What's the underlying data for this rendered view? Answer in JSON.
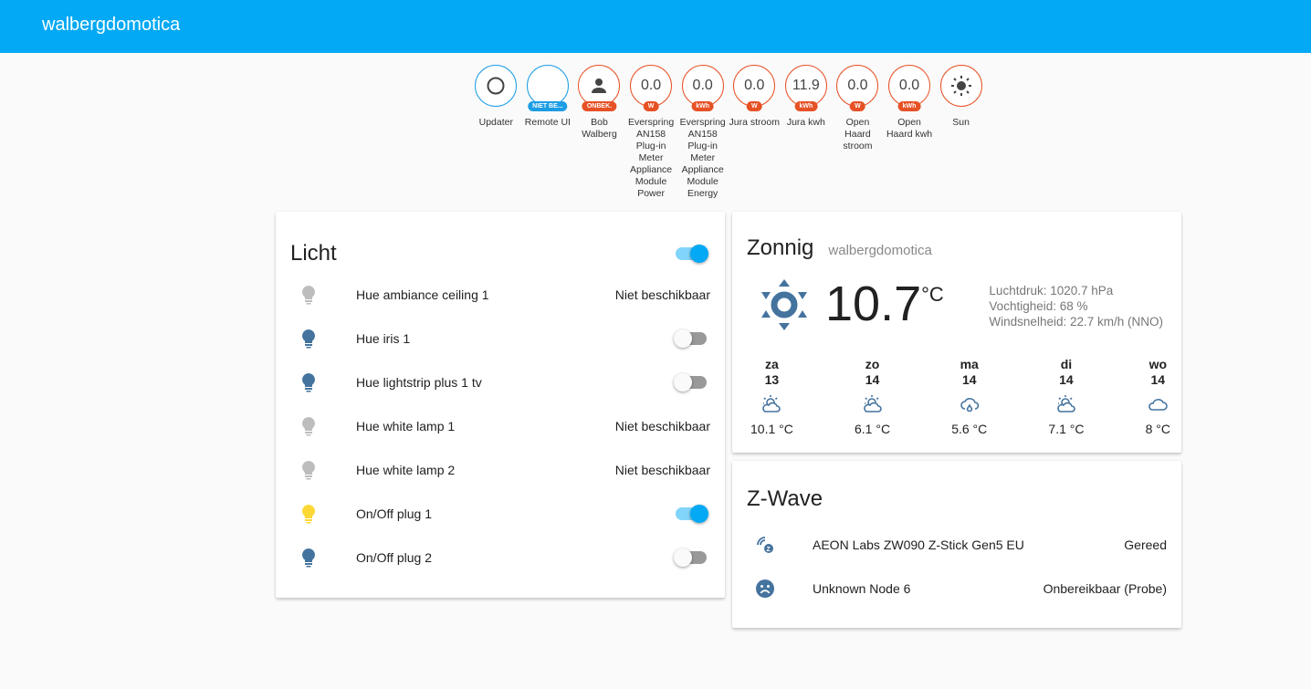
{
  "header": {
    "title": "walbergdomotica"
  },
  "badges": [
    {
      "value": "",
      "icon": "circle-outline-icon",
      "tag": "",
      "label": "Updater",
      "color": "blue"
    },
    {
      "value": "",
      "icon": "",
      "tag": "NIET BE...",
      "label": "Remote UI",
      "color": "blue"
    },
    {
      "value": "",
      "icon": "person-icon",
      "tag": "ONBEK.",
      "label": "Bob Walberg",
      "color": "red"
    },
    {
      "value": "0.0",
      "icon": "",
      "tag": "W",
      "label": "Everspring AN158 Plug-in Meter Appliance Module Power",
      "color": "red"
    },
    {
      "value": "0.0",
      "icon": "",
      "tag": "kWh",
      "label": "Everspring AN158 Plug-in Meter Appliance Module Energy",
      "color": "red"
    },
    {
      "value": "0.0",
      "icon": "",
      "tag": "W",
      "label": "Jura stroom",
      "color": "red"
    },
    {
      "value": "11.9",
      "icon": "",
      "tag": "kWh",
      "label": "Jura kwh",
      "color": "red"
    },
    {
      "value": "0.0",
      "icon": "",
      "tag": "W",
      "label": "Open Haard stroom",
      "color": "red"
    },
    {
      "value": "0.0",
      "icon": "",
      "tag": "kWh",
      "label": "Open Haard kwh",
      "color": "red"
    },
    {
      "value": "",
      "icon": "sun-icon",
      "tag": "",
      "label": "Sun",
      "color": "red"
    }
  ],
  "licht": {
    "title": "Licht",
    "master_on": true,
    "items": [
      {
        "name": "Hue ambiance ceiling 1",
        "state": "Niet beschikbaar",
        "icon_color": "#bdbdbd"
      },
      {
        "name": "Hue iris 1",
        "toggle": false,
        "icon_color": "#44739e"
      },
      {
        "name": "Hue lightstrip plus 1 tv",
        "toggle": false,
        "icon_color": "#44739e"
      },
      {
        "name": "Hue white lamp 1",
        "state": "Niet beschikbaar",
        "icon_color": "#bdbdbd"
      },
      {
        "name": "Hue white lamp 2",
        "state": "Niet beschikbaar",
        "icon_color": "#bdbdbd"
      },
      {
        "name": "On/Off plug 1",
        "toggle": true,
        "icon_color": "#fdd835"
      },
      {
        "name": "On/Off plug 2",
        "toggle": false,
        "icon_color": "#44739e"
      }
    ]
  },
  "weather": {
    "condition": "Zonnig",
    "location": "walbergdomotica",
    "temp": "10.7",
    "unit": "°C",
    "details": [
      "Luchtdruk: 1020.7 hPa",
      "Vochtigheid: 68 %",
      "Windsnelheid: 22.7 km/h (NNO)"
    ],
    "forecast": [
      {
        "day": "za",
        "date": "13",
        "icon": "partly-cloudy-icon",
        "temp": "10.1 °C"
      },
      {
        "day": "zo",
        "date": "14",
        "icon": "partly-cloudy-icon",
        "temp": "6.1 °C"
      },
      {
        "day": "ma",
        "date": "14",
        "icon": "rain-icon",
        "temp": "5.6 °C"
      },
      {
        "day": "di",
        "date": "14",
        "icon": "partly-cloudy-icon",
        "temp": "7.1 °C"
      },
      {
        "day": "wo",
        "date": "14",
        "icon": "cloud-icon",
        "temp": "8 °C"
      }
    ]
  },
  "zwave": {
    "title": "Z-Wave",
    "items": [
      {
        "name": "AEON Labs ZW090 Z-Stick Gen5 EU",
        "state": "Gereed",
        "icon": "zwave-icon"
      },
      {
        "name": "Unknown Node 6",
        "state": "Onbereikbaar (Probe)",
        "icon": "sad-face-icon"
      }
    ]
  },
  "colors": {
    "primary": "#03a9f4",
    "badge_red": "#e65125",
    "icon_blue": "#44739e"
  }
}
